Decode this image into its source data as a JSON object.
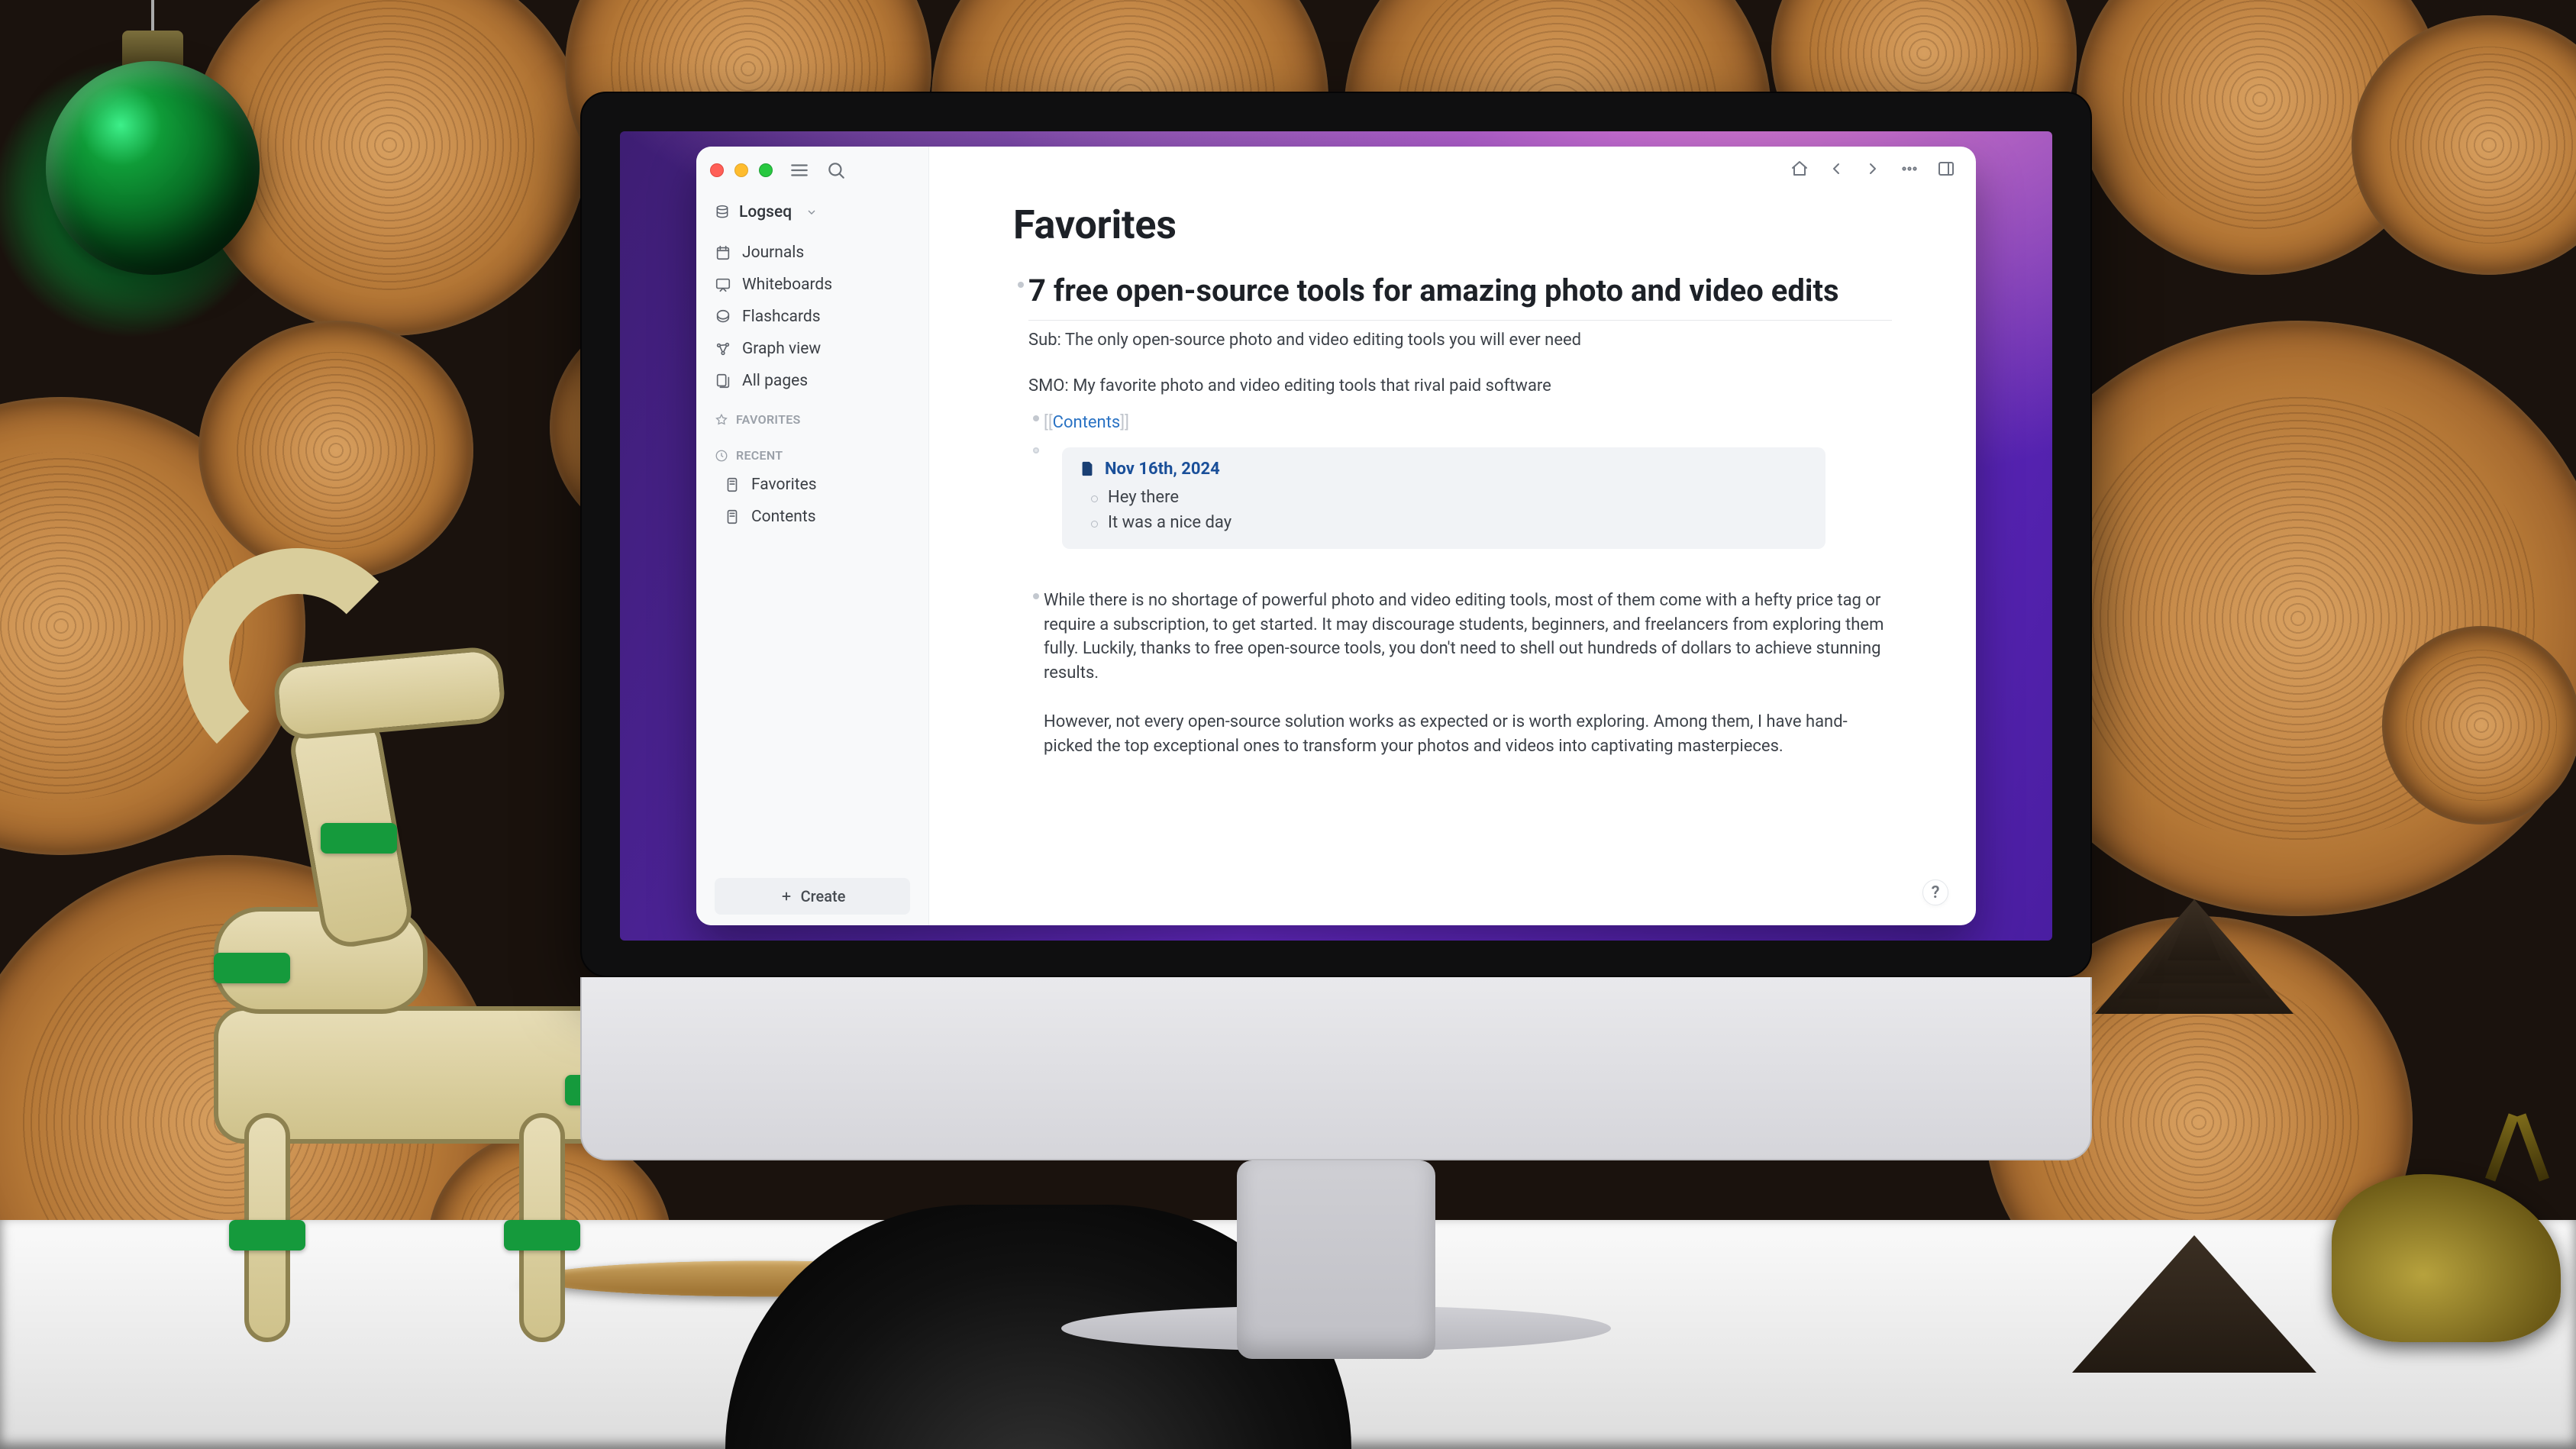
{
  "workspace": {
    "name": "Logseq"
  },
  "sidebar": {
    "nav": [
      {
        "label": "Journals"
      },
      {
        "label": "Whiteboards"
      },
      {
        "label": "Flashcards"
      },
      {
        "label": "Graph view"
      },
      {
        "label": "All pages"
      }
    ],
    "sections": {
      "favorites": {
        "header": "FAVORITES",
        "items": []
      },
      "recent": {
        "header": "RECENT",
        "items": [
          {
            "label": "Favorites"
          },
          {
            "label": "Contents"
          }
        ]
      }
    },
    "create": "Create"
  },
  "page": {
    "title": "Favorites",
    "heading": "7 free open-source tools for amazing photo and video edits",
    "sub": "Sub: The only open-source photo and video editing tools you will ever need",
    "smo": "SMO: My favorite photo and video editing tools that rival paid software",
    "contents_tag": "Contents",
    "embed": {
      "date": "Nov 16th, 2024",
      "items": [
        "Hey there",
        "It was a nice day"
      ]
    },
    "body1": "While there is no shortage of powerful photo and video editing tools, most of them come with a hefty price tag or require a subscription, to get started. It may discourage students, beginners, and freelancers from exploring them fully. Luckily, thanks to free open-source tools, you don't need to shell out hundreds of dollars to achieve stunning results.",
    "body2": "However, not every open-source solution works as expected or is worth exploring. Among them, I have hand-picked the top exceptional ones to transform your photos and videos into captivating masterpieces."
  },
  "help": "?"
}
